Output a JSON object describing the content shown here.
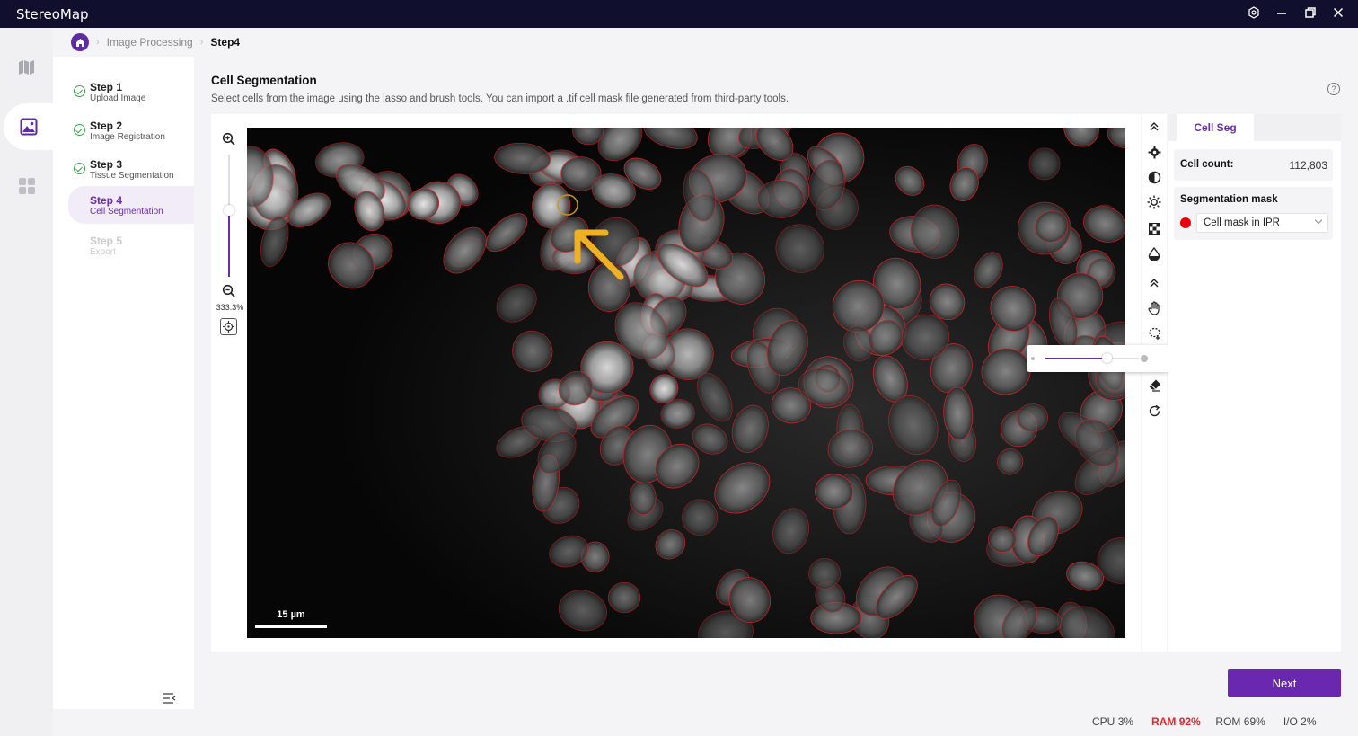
{
  "app": {
    "title": "StereoMap"
  },
  "breadcrumb": {
    "parent": "Image Processing",
    "current": "Step4"
  },
  "steps": [
    {
      "title": "Step 1",
      "subtitle": "Upload Image",
      "state": "done"
    },
    {
      "title": "Step 2",
      "subtitle": "Image Registration",
      "state": "done"
    },
    {
      "title": "Step 3",
      "subtitle": "Tissue Segmentation",
      "state": "done"
    },
    {
      "title": "Step 4",
      "subtitle": "Cell Segmentation",
      "state": "active"
    },
    {
      "title": "Step 5",
      "subtitle": "Export",
      "state": "disabled"
    }
  ],
  "page": {
    "title": "Cell Segmentation",
    "description": "Select cells from the image using the lasso and brush tools. You can import a .tif cell mask file generated from third-party tools."
  },
  "zoom": {
    "label": "333.3%",
    "level_fraction": 0.55
  },
  "image": {
    "scale_bar_label": "15 µm"
  },
  "toolbar": {
    "tools": [
      "collapse-up-icon",
      "settings-gear-icon",
      "contrast-icon",
      "brightness-icon",
      "checker-icon",
      "opacity-drop-icon",
      "collapse-up-icon",
      "hand-pan-icon",
      "lasso-icon",
      "brush-icon",
      "eraser-icon",
      "redo-icon"
    ]
  },
  "brush_popover": {
    "size_fraction": 0.7
  },
  "panel": {
    "tab": "Cell Seg",
    "cell_count_label": "Cell count:",
    "cell_count_value": "112,803",
    "mask_label": "Segmentation mask",
    "mask_select": "Cell mask in IPR",
    "mask_color": "#e8000b"
  },
  "actions": {
    "next": "Next"
  },
  "status": {
    "cpu_label": "CPU",
    "cpu_value": "3%",
    "ram_label": "RAM",
    "ram_value": "92%",
    "rom_label": "ROM",
    "rom_value": "69%",
    "io_label": "I/O",
    "io_value": "2%"
  },
  "colors": {
    "accent": "#6b2db0",
    "annotation_arrow": "#f0b023",
    "cell_outline": "#d8262b"
  }
}
